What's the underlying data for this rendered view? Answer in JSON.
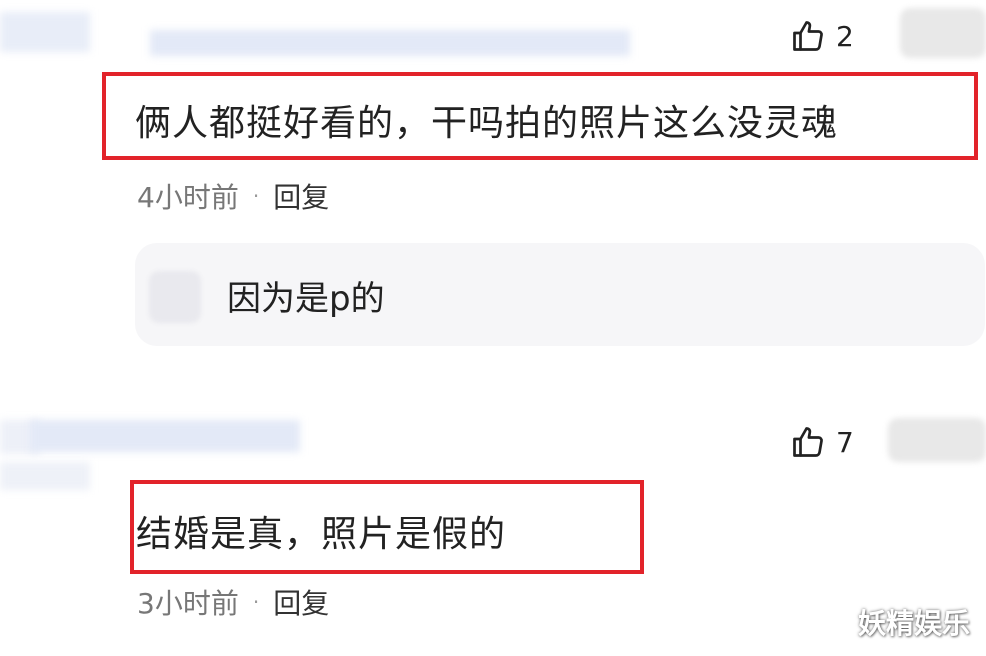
{
  "comments": [
    {
      "likes": "2",
      "text": "俩人都挺好看的，干吗拍的照片这么没灵魂",
      "time": "4小时前",
      "reply_label": "回复",
      "separator": "·",
      "nested_reply": {
        "text": "因为是p的"
      }
    },
    {
      "likes": "7",
      "text": "结婚是真，照片是假的",
      "time": "3小时前",
      "reply_label": "回复",
      "separator": "·"
    }
  ],
  "watermark": "妖精娱乐",
  "colors": {
    "highlight_border": "#e2232a",
    "meta_text": "#777777",
    "reply_card_bg": "#f6f6f8"
  },
  "icons": {
    "like": "thumbs-up-icon"
  }
}
